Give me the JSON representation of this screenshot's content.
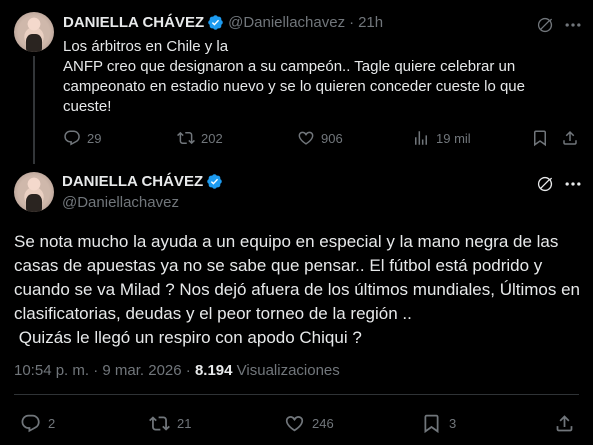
{
  "parent_tweet": {
    "display_name": "DANIELLA CHÁVEZ",
    "handle": "@Daniellachavez",
    "separator": "·",
    "time": "21h",
    "text": "Los árbitros en Chile y la\nANFP creo que designaron a su campeón.. Tagle quiere celebrar un campeonato en estadio nuevo y se lo quieren conceder cueste lo que cueste!",
    "replies": "29",
    "reposts": "202",
    "likes": "906",
    "views": "19 mil"
  },
  "main_tweet": {
    "display_name": "DANIELLA CHÁVEZ",
    "handle": "@Daniellachavez",
    "text": "Se nota mucho la ayuda a un equipo en especial y la mano negra de las casas de apuestas ya no se sabe que pensar.. El fútbol está podrido y cuando se va Milad ? Nos dejó afuera de los últimos mundiales, Últimos en clasificatorias, deudas y el peor torneo de la región ..\n Quizás le llegó un respiro con apodo Chiqui ?",
    "timestamp": "10:54 p. m. · 9 mar. 2026 ·",
    "views_count": "8.194",
    "views_label": "Visualizaciones",
    "replies": "2",
    "reposts": "21",
    "likes": "246",
    "bookmarks": "3"
  },
  "colors": {
    "background": "#000000",
    "text_primary": "#e7e9ea",
    "text_secondary": "#71767b",
    "verified_blue": "#1d9bf0",
    "divider": "#2f3336"
  },
  "icons": [
    "verified-badge-icon",
    "grok-icon",
    "more-icon",
    "reply-icon",
    "repost-icon",
    "like-icon",
    "views-icon",
    "bookmark-icon",
    "share-icon"
  ]
}
